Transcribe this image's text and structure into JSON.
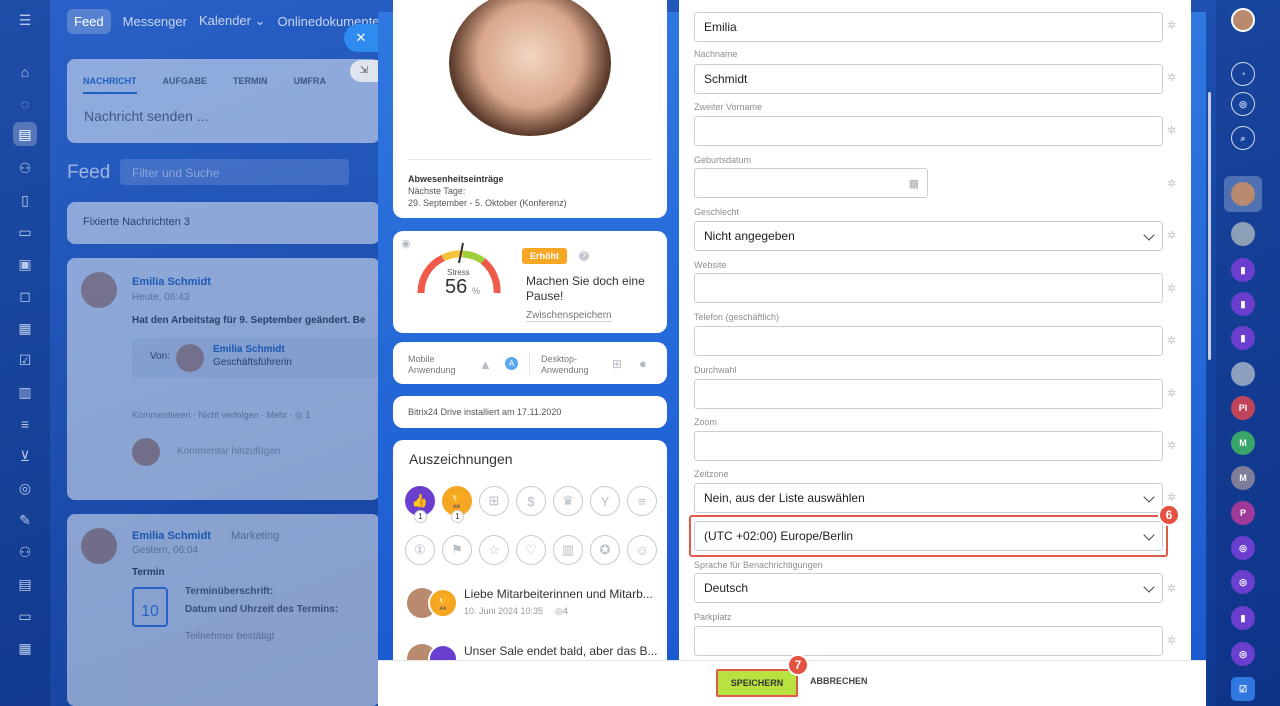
{
  "topnav": {
    "feed": "Feed",
    "messenger": "Messenger",
    "calendar": "Kalender",
    "docs": "Onlinedokumente"
  },
  "bg": {
    "tab1": "NACHRICHT",
    "tab2": "AUFGABE",
    "tab3": "TERMIN",
    "tab4": "UMFRA",
    "compose": "Nachricht senden ...",
    "feed_title": "Feed",
    "search_ph": "Filter und Suche",
    "pinned": "Fixierte Nachrichten 3",
    "post1_author": "Emilia Schmidt",
    "post1_time": "Heute, 06:43",
    "post1_text": "Hat den Arbeitstag für 9. September geändert. Be",
    "from_label": "Von:",
    "from_name": "Emilia Schmidt",
    "from_role": "Geschäftsführerin",
    "actions": "Kommentieren · Nicht verfolgen · Mehr · ◎ 1",
    "comment_ph": "Kommentar hinzufügen",
    "post2_author": "Emilia Schmidt",
    "post2_group": "Marketing",
    "post2_time": "Gestern, 06:04",
    "post2_type": "Termin",
    "ev_title": "Terminüberschrift:",
    "ev_date": "Datum und Uhrzeit des Termins:",
    "ev_confirm": "Teilnehmer bestätigt",
    "cal_num": "10"
  },
  "profile": {
    "absence_title": "Abwesenheitseinträge",
    "absence_next": "Nächste Tage:",
    "absence_dates": "29. September - 5. Oktober (Konferenz)",
    "stress_label": "Stress",
    "stress_value": "56",
    "stress_unit": "%",
    "stress_badge": "Erhöht",
    "stress_msg": "Machen Sie doch eine Pause!",
    "stress_save": "Zwischenspeichern",
    "mobile_app": "Mobile Anwendung",
    "desktop_app": "Desktop-Anwendung",
    "drive": "Bitrix24 Drive installiert am 17.11.2020",
    "awards_title": "Auszeichnungen",
    "award_count1": "1",
    "award_count2": "1",
    "news1_text": "Liebe Mitarbeiterinnen und Mitarb...",
    "news1_date": "10. Juni 2024 10:35",
    "news1_views": "4",
    "news2_text": "Unser Sale endet bald, aber das B..."
  },
  "form": {
    "first_name": "Emilia",
    "last_name_label": "Nachname",
    "last_name": "Schmidt",
    "middle_label": "Zweiter Vorname",
    "middle": "",
    "birth_label": "Geburtsdatum",
    "gender_label": "Geschlecht",
    "gender": "Nicht angegeben",
    "website_label": "Website",
    "phone_label": "Telefon (geschäftlich)",
    "ext_label": "Durchwahl",
    "zoom_label": "Zoom",
    "tz_label": "Zeitzone",
    "tz_mode": "Nein, aus der Liste auswählen",
    "tz_value": "(UTC +02:00) Europe/Berlin",
    "lang_label": "Sprache für Benachrichtigungen",
    "lang": "Deutsch",
    "parking_label": "Parkplatz"
  },
  "footer": {
    "save": "SPEICHERN",
    "cancel": "ABBRECHEN"
  },
  "steps": {
    "s6": "6",
    "s7": "7"
  },
  "right_rail": {
    "pl": "Pl",
    "m1": "M",
    "m2": "M",
    "p": "P"
  },
  "colors": {
    "accent": "#2f78e0",
    "save_green": "#b8e240",
    "highlight_red": "#e05a4a",
    "badge_orange": "#f5a623"
  }
}
